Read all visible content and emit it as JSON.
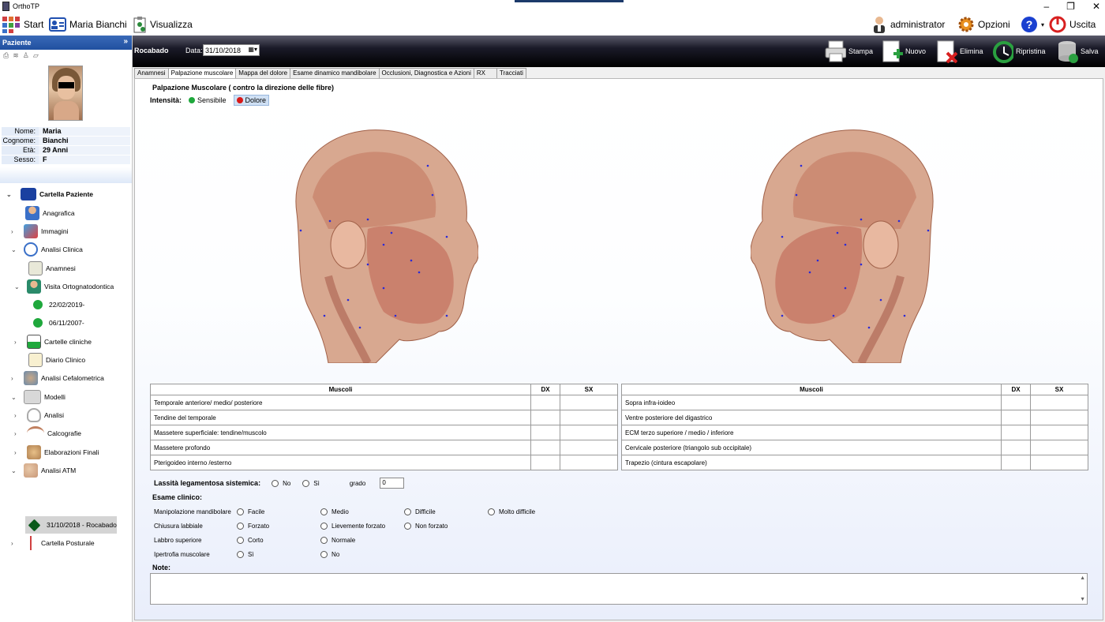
{
  "window": {
    "title": "OrthoTP"
  },
  "toolbar": {
    "start": "Start",
    "patient": "Maria Bianchi",
    "view": "Visualizza",
    "user": "administrator",
    "options": "Opzioni",
    "help": "?",
    "exit": "Uscita"
  },
  "sidebar": {
    "header": "Paziente",
    "patient": [
      {
        "k": "Nome:",
        "v": "Maria"
      },
      {
        "k": "Cognome:",
        "v": "Bianchi"
      },
      {
        "k": "Età:",
        "v": "29 Anni"
      },
      {
        "k": "Sesso:",
        "v": "F"
      }
    ],
    "tree": {
      "root": "Cartella Paziente",
      "anagrafica": "Anagrafica",
      "immagini": "Immagini",
      "analisi_clinica": "Analisi Clinica",
      "anamnesi": "Anamnesi",
      "visita": "Visita Ortognatodontica",
      "v1": "22/02/2019-",
      "v2": "06/11/2007-",
      "cartelle": "Cartelle cliniche",
      "diario": "Diario Clinico",
      "cefalometrica": "Analisi Cefalometrica",
      "modelli": "Modelli",
      "analisi": "Analisi",
      "calcografie": "Calcografie",
      "elaborazioni": "Elaborazioni Finali",
      "atm": "Analisi ATM",
      "atm_item": "31/10/2018 - Rocabado",
      "posturale": "Cartella Posturale"
    }
  },
  "header": {
    "title": "Rocabado",
    "date_label": "Data:",
    "date": "31/10/2018",
    "stampa": "Stampa",
    "nuovo": "Nuovo",
    "elimina": "Elimina",
    "ripristina": "Ripristina",
    "salva": "Salva"
  },
  "tabs": [
    "Anamnesi",
    "Palpazione muscolare",
    "Mappa del dolore",
    "Esame dinamico mandibolare",
    "Occlusioni, Diagnostica e Azioni",
    "RX",
    "Tracciati"
  ],
  "content": {
    "title": "Palpazione Muscolare ( contro la direzione delle fibre)",
    "intensity_label": "Intensità:",
    "sensibile": "Sensibile",
    "dolore": "Dolore"
  },
  "table_left": {
    "h": [
      "Muscoli",
      "DX",
      "SX"
    ],
    "rows": [
      "Temporale anteriore/ medio/ posteriore",
      "Tendine del temporale",
      "Massetere superficiale: tendine/muscolo",
      "Massetere profondo",
      "Pterigoideo interno /esterno"
    ]
  },
  "table_right": {
    "h": [
      "Muscoli",
      "DX",
      "SX"
    ],
    "rows": [
      "Sopra infra-ioideo",
      "Ventre posteriore del digastrico",
      "ECM terzo superiore / medio / inferiore",
      "Cervicale posteriore (triangolo sub occipitale)",
      "Trapezio (cintura escapolare)"
    ]
  },
  "form": {
    "lassita": "Lassità legamentosa sistemica:",
    "no": "No",
    "si": "Sì",
    "grado": "grado",
    "grado_val": "0",
    "esame": "Esame clinico:",
    "manip": "Manipolazione mandibolare",
    "facile": "Facile",
    "medio": "Medio",
    "difficile": "Difficile",
    "molto": "Molto difficile",
    "chiusura": "Chiusura labbiale",
    "forzato": "Forzato",
    "lieve": "Lievemente forzato",
    "nonforzato": "Non forzato",
    "labbro": "Labbro superiore",
    "corto": "Corto",
    "normale": "Normale",
    "ipertrofia": "Ipertrofia muscolare",
    "si2": "Sì",
    "no2": "No",
    "note": "Note:"
  },
  "colors": {
    "green": "#1fa83c",
    "red": "#d81818"
  }
}
